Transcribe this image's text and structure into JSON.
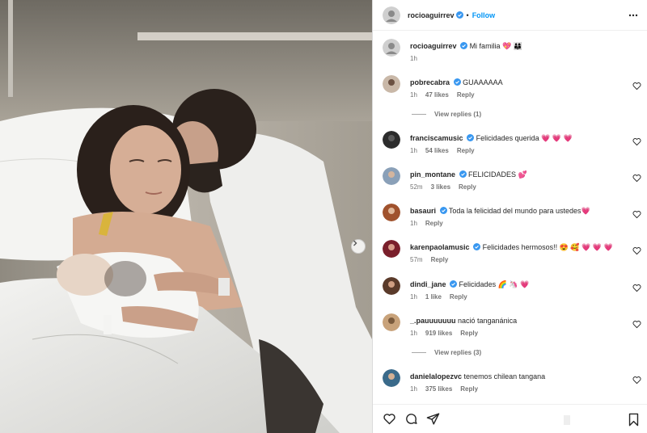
{
  "header": {
    "username": "rocioaguirrev",
    "separator": "•",
    "follow_label": "Follow"
  },
  "caption": {
    "username": "rocioaguirrev",
    "text": "Mi familia 💖 👨‍👩‍👦",
    "time": "1h"
  },
  "comments": [
    {
      "username": "pobrecabra",
      "verified": true,
      "text": "GUAAAAAA",
      "time": "1h",
      "likes": "47 likes",
      "reply": "Reply",
      "avatar_color": "#c9b8a8"
    },
    {
      "username": "franciscamusic",
      "verified": true,
      "text": "Felicidades querida 💗 💗 💗",
      "time": "1h",
      "likes": "54 likes",
      "reply": "Reply",
      "avatar_color": "#2c2c2c"
    },
    {
      "username": "pin_montane",
      "verified": true,
      "text": "FELICIDADES 💕",
      "time": "52m",
      "likes": "3 likes",
      "reply": "Reply",
      "avatar_color": "#8aa0b8"
    },
    {
      "username": "basauri",
      "verified": true,
      "text": "Toda la felicidad del mundo para ustedes💗",
      "time": "1h",
      "likes": "",
      "reply": "Reply",
      "avatar_color": "#a0522d"
    },
    {
      "username": "karenpaolamusic",
      "verified": true,
      "text": "Felicidades hermosos!! 😍 🥰 💗 💗 💗",
      "time": "57m",
      "likes": "",
      "reply": "Reply",
      "avatar_color": "#7a1f2b"
    },
    {
      "username": "dindi_jane",
      "verified": true,
      "text": "Felicidades 🌈 🦄 💗",
      "time": "1h",
      "likes": "1 like",
      "reply": "Reply",
      "avatar_color": "#5a3a2a"
    },
    {
      "username": "_.pauuuuuuu",
      "verified": false,
      "text": "nació tanganánica",
      "time": "1h",
      "likes": "919 likes",
      "reply": "Reply",
      "avatar_color": "#c8a27a"
    },
    {
      "username": "danielalopezvc",
      "verified": false,
      "text": "tenemos chilean tangana",
      "time": "1h",
      "likes": "375 likes",
      "reply": "Reply",
      "avatar_color": "#3a6a8a"
    }
  ],
  "view_replies": [
    {
      "label": "View replies (1)"
    },
    {
      "label": "View replies (3)"
    }
  ],
  "colors": {
    "accent": "#0095f6",
    "verified": "#3897f0",
    "heart_emoji": "#e0245e"
  }
}
